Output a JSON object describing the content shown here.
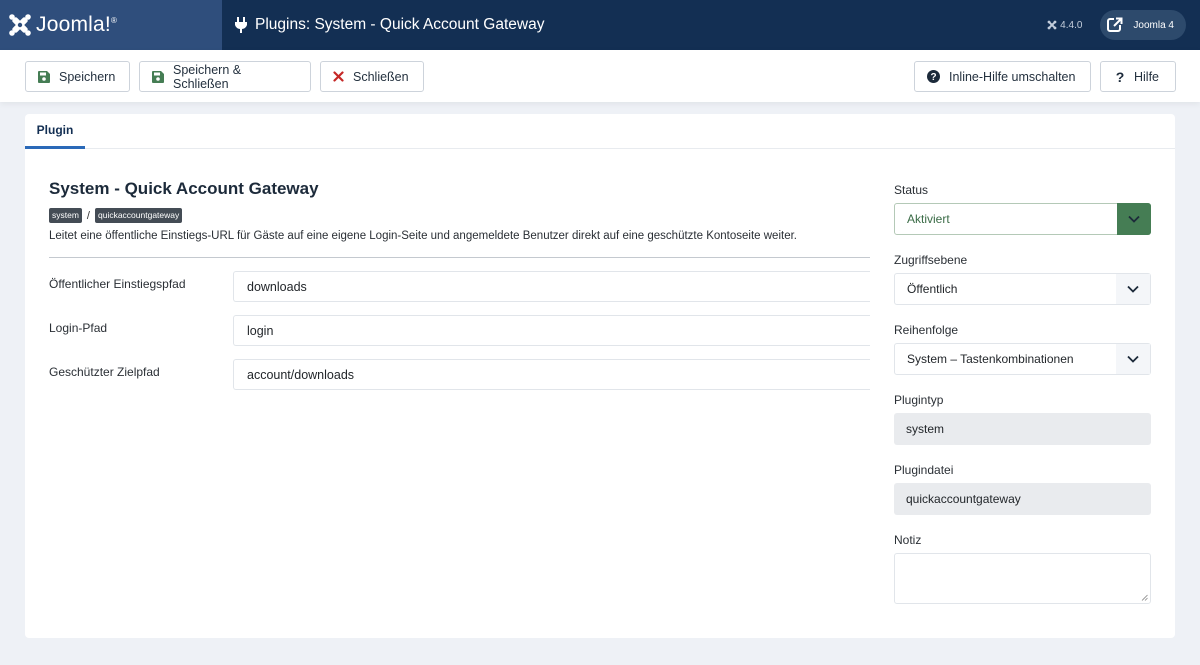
{
  "header": {
    "logo_text": "Joomla!",
    "page_title": "Plugins: System - Quick Account Gateway",
    "version": "4.4.0",
    "j4_label": "Joomla 4"
  },
  "toolbar": {
    "save_label": "Speichern",
    "save_close_label": "Speichern & Schließen",
    "close_label": "Schließen",
    "inline_help_label": "Inline-Hilfe umschalten",
    "help_label": "Hilfe"
  },
  "tabs": [
    {
      "label": "Plugin"
    }
  ],
  "plugin": {
    "title": "System - Quick Account Gateway",
    "folder_badge": "system",
    "separator": "/",
    "element_badge": "quickaccountgateway",
    "description": "Leitet eine öffentliche Einstiegs-URL für Gäste auf eine eigene Login-Seite und angemeldete Benutzer direkt auf eine geschützte Kontoseite weiter."
  },
  "fields": [
    {
      "label": "Öffentlicher Einstiegspfad",
      "value": "downloads"
    },
    {
      "label": "Login-Pfad",
      "value": "login"
    },
    {
      "label": "Geschützter Zielpfad",
      "value": "account/downloads"
    }
  ],
  "sidebar": {
    "status_label": "Status",
    "status_value": "Aktiviert",
    "access_label": "Zugriffsebene",
    "access_value": "Öffentlich",
    "ordering_label": "Reihenfolge",
    "ordering_value": "System – Tastenkombinationen",
    "type_label": "Plugintyp",
    "type_value": "system",
    "file_label": "Plugindatei",
    "file_value": "quickaccountgateway",
    "note_label": "Notiz",
    "note_value": ""
  },
  "colors": {
    "header_bg": "#132f53",
    "logo_bg": "#2f4e7c",
    "status_green": "#457d54",
    "tab_accent": "#2a69b8",
    "close_red": "#c52827"
  }
}
